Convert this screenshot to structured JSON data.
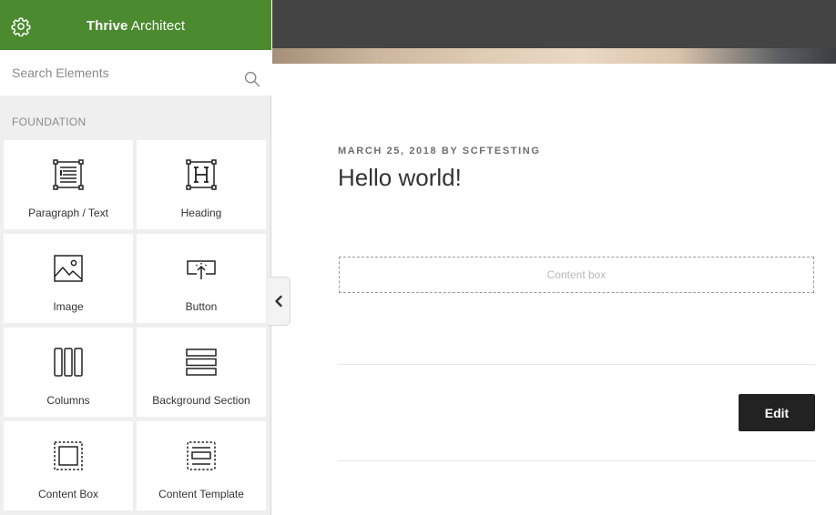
{
  "sidebar": {
    "header": {
      "title_bold": "Thrive",
      "title_rest": " Architect",
      "settings_icon": "gear-icon",
      "background": "#4b8a2f"
    },
    "search": {
      "placeholder": "Search Elements",
      "icon": "search-icon"
    },
    "section_title": "FOUNDATION",
    "elements": [
      {
        "label": "Paragraph / Text",
        "icon": "paragraph-text-icon"
      },
      {
        "label": "Heading",
        "icon": "heading-icon"
      },
      {
        "label": "Image",
        "icon": "image-icon"
      },
      {
        "label": "Button",
        "icon": "button-icon"
      },
      {
        "label": "Columns",
        "icon": "columns-icon"
      },
      {
        "label": "Background Section",
        "icon": "background-section-icon"
      },
      {
        "label": "Content Box",
        "icon": "content-box-icon"
      },
      {
        "label": "Content Template",
        "icon": "content-template-icon"
      }
    ],
    "collapse_icon": "chevron-left-icon"
  },
  "post": {
    "meta": "MARCH 25, 2018 BY SCFTESTING",
    "title": "Hello world!",
    "content_box_placeholder": "Content box",
    "edit_label": "Edit"
  }
}
